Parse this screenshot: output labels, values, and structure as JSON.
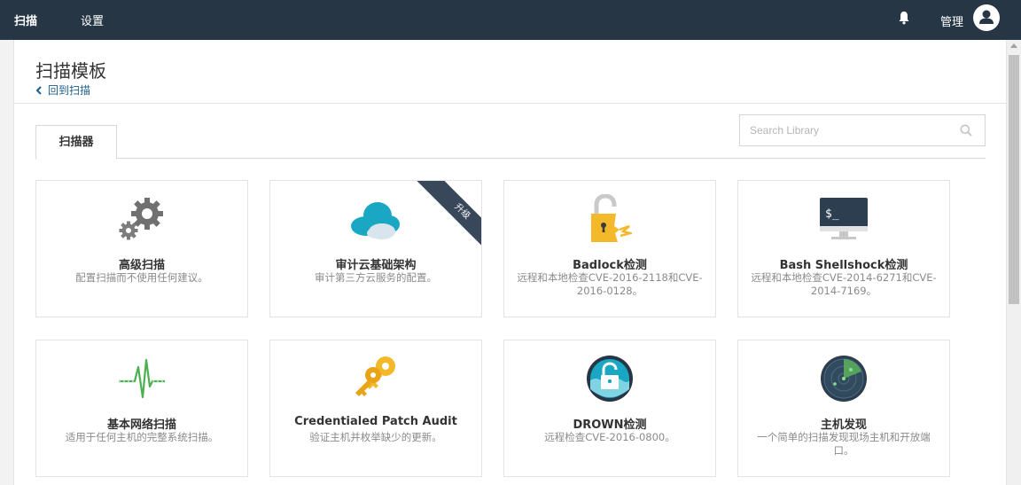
{
  "nav": {
    "scan_label": "扫描",
    "settings_label": "设置",
    "user_label": "管理"
  },
  "page": {
    "title": "扫描模板",
    "back_label": "回到扫描"
  },
  "tabs": [
    {
      "label": "扫描器",
      "active": true
    }
  ],
  "search": {
    "placeholder": "Search Library"
  },
  "templates": [
    {
      "icon": "gears-icon",
      "title": "高级扫描",
      "description": "配置扫描而不使用任何建议。"
    },
    {
      "icon": "cloud-icon",
      "title": "审计云基础架构",
      "description": "审计第三方云服务的配置。",
      "badge": "升级"
    },
    {
      "icon": "broken-lock-icon",
      "title": "Badlock检测",
      "description": "远程和本地检查CVE-2016-2118和CVE-2016-0128。"
    },
    {
      "icon": "terminal-icon",
      "title": "Bash Shellshock检测",
      "description": "远程和本地检查CVE-2014-6271和CVE-2014-7169。"
    },
    {
      "icon": "pulse-icon",
      "title": "基本网络扫描",
      "description": "适用于任何主机的完整系统扫描。"
    },
    {
      "icon": "keys-icon",
      "title": "Credentialed Patch Audit",
      "description": "验证主机并枚举缺少的更新。"
    },
    {
      "icon": "drown-lock-icon",
      "title": "DROWN检测",
      "description": "远程检查CVE-2016-0800。"
    },
    {
      "icon": "radar-icon",
      "title": "主机发现",
      "description": "一个简单的扫描发现现场主机和开放端口。"
    }
  ],
  "colors": {
    "topbar": "#263645",
    "link": "#1b5e8c",
    "ribbon": "#38485a"
  }
}
